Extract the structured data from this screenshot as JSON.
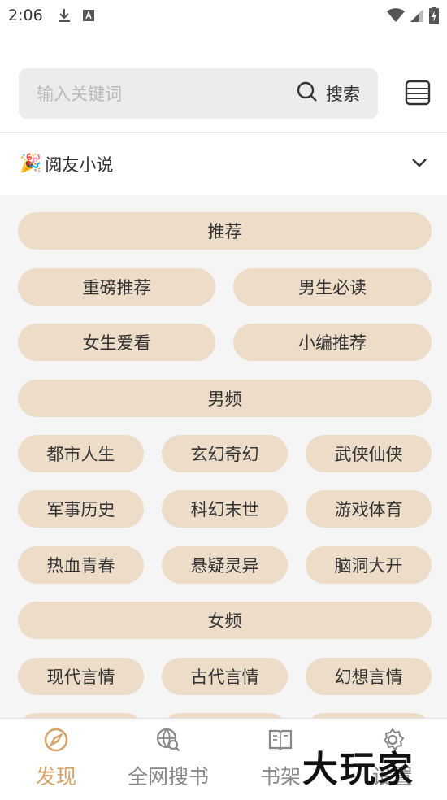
{
  "status_bar": {
    "time": "2:06"
  },
  "search": {
    "placeholder": "输入关键词",
    "button_label": "搜索"
  },
  "source": {
    "label": "阅友小说"
  },
  "categories": [
    {
      "label": "推荐",
      "type": "header"
    },
    {
      "label": "重磅推荐"
    },
    {
      "label": "男生必读"
    },
    {
      "label": "女生爱看"
    },
    {
      "label": "小编推荐"
    },
    {
      "label": "男频",
      "type": "header"
    },
    {
      "label": "都市人生"
    },
    {
      "label": "玄幻奇幻"
    },
    {
      "label": "武侠仙侠"
    },
    {
      "label": "军事历史"
    },
    {
      "label": "科幻末世"
    },
    {
      "label": "游戏体育"
    },
    {
      "label": "热血青春"
    },
    {
      "label": "悬疑灵异"
    },
    {
      "label": "脑洞大开"
    },
    {
      "label": "女频",
      "type": "header"
    },
    {
      "label": "现代言情"
    },
    {
      "label": "古代言情"
    },
    {
      "label": "幻想言情"
    }
  ],
  "bottom_nav": [
    {
      "label": "发现",
      "icon": "compass-icon",
      "active": true
    },
    {
      "label": "全网搜书",
      "icon": "globe-search-icon",
      "active": false
    },
    {
      "label": "书架",
      "icon": "book-icon",
      "active": false
    },
    {
      "label": "设置",
      "icon": "gear-icon",
      "active": false
    }
  ],
  "watermark": "大玩家",
  "colors": {
    "accent": "#d4a36a",
    "pill": "#ecdcc8",
    "content_bg": "#f5f5f5"
  }
}
